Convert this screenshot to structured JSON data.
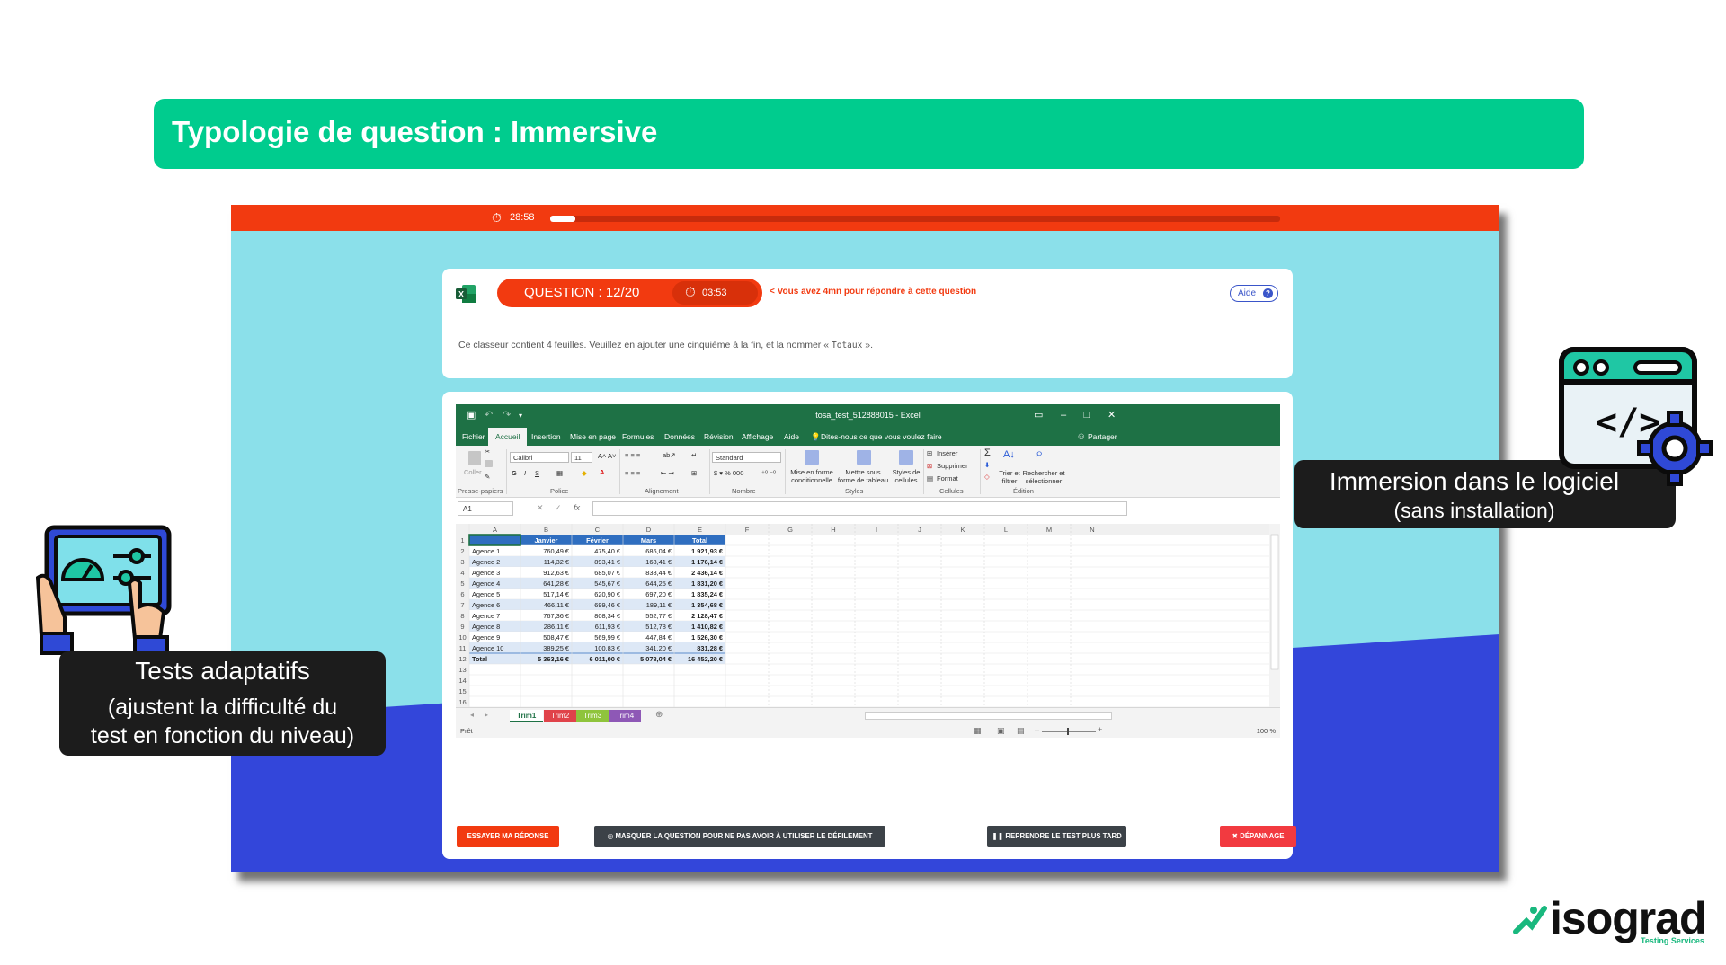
{
  "banner": {
    "title": "Typologie de question : Immersive"
  },
  "test": {
    "global_timer": "28:58",
    "progress": 0.035,
    "question_label": "QUESTION : 12/20",
    "question_timer": "03:53",
    "hint": "< Vous avez 4mn pour répondre à cette question",
    "help_label": "Aide",
    "question_text": "Ce classeur contient 4 feuilles. Veuillez en ajouter une cinquième à la fin, et la nommer «",
    "question_code": "Totaux",
    "question_end": "»."
  },
  "excel": {
    "window_title": "tosa_test_512888015 - Excel",
    "tabs": [
      "Fichier",
      "Accueil",
      "Insertion",
      "Mise en page",
      "Formules",
      "Données",
      "Révision",
      "Affichage",
      "Aide"
    ],
    "tell_me": "Dites-nous ce que vous voulez faire",
    "share": "Partager",
    "ribbon": {
      "paste": "Coller",
      "font": "Calibri",
      "size": "11",
      "number_format": "Standard",
      "cond_format": "Mise en forme conditionnelle",
      "table_format": "Mettre sous forme de tableau",
      "cell_styles": "Styles de cellules",
      "insert": "Insérer",
      "delete": "Supprimer",
      "format": "Format",
      "sort": "Trier et filtrer",
      "find": "Rechercher et sélectionner",
      "groups": [
        "Presse-papiers",
        "Police",
        "Alignement",
        "Nombre",
        "Styles",
        "Cellules",
        "Édition"
      ]
    },
    "name_box": "A1",
    "columns": [
      "A",
      "B",
      "C",
      "D",
      "E",
      "F",
      "G",
      "H",
      "I",
      "J",
      "K",
      "L",
      "M",
      "N"
    ],
    "header_row": [
      "",
      "Janvier",
      "Février",
      "Mars",
      "Total"
    ],
    "rows": [
      [
        "Agence 1",
        "760,49 €",
        "475,40 €",
        "686,04 €",
        "1 921,93 €"
      ],
      [
        "Agence 2",
        "114,32 €",
        "893,41 €",
        "168,41 €",
        "1 176,14 €"
      ],
      [
        "Agence 3",
        "912,63 €",
        "685,07 €",
        "838,44 €",
        "2 436,14 €"
      ],
      [
        "Agence 4",
        "641,28 €",
        "545,67 €",
        "644,25 €",
        "1 831,20 €"
      ],
      [
        "Agence 5",
        "517,14 €",
        "620,90 €",
        "697,20 €",
        "1 835,24 €"
      ],
      [
        "Agence 6",
        "466,11 €",
        "699,46 €",
        "189,11 €",
        "1 354,68 €"
      ],
      [
        "Agence 7",
        "767,36 €",
        "808,34 €",
        "552,77 €",
        "2 128,47 €"
      ],
      [
        "Agence 8",
        "286,11 €",
        "611,93 €",
        "512,78 €",
        "1 410,82 €"
      ],
      [
        "Agence 9",
        "508,47 €",
        "569,99 €",
        "447,84 €",
        "1 526,30 €"
      ],
      [
        "Agence 10",
        "389,25 €",
        "100,83 €",
        "341,20 €",
        "831,28 €"
      ],
      [
        "Total",
        "5 363,16 €",
        "6 011,00 €",
        "5 078,04 €",
        "16 452,20 €"
      ]
    ],
    "row_numbers": [
      "1",
      "2",
      "3",
      "4",
      "5",
      "6",
      "7",
      "8",
      "9",
      "10",
      "11",
      "12",
      "13",
      "14",
      "15",
      "16"
    ],
    "sheets": [
      {
        "name": "Trim1",
        "color": "#ffffff"
      },
      {
        "name": "Trim2",
        "color": "#e0434a"
      },
      {
        "name": "Trim3",
        "color": "#8fc43c"
      },
      {
        "name": "Trim4",
        "color": "#8e58b6"
      }
    ],
    "status": "Prêt",
    "zoom": "100 %"
  },
  "buttons": {
    "try": "ESSAYER MA RÉPONSE",
    "hide": "MASQUER LA QUESTION POUR NE PAS AVOIR À UTILISER LE DÉFILEMENT",
    "later": "REPRENDRE LE TEST PLUS TARD",
    "help": "DÉPANNAGE"
  },
  "callouts": {
    "right_title": "Immersion dans le logiciel",
    "right_sub": "(sans installation)",
    "left_title": "Tests adaptatifs",
    "left_sub1": "(ajustent la difficulté du",
    "left_sub2": "test en fonction du niveau)"
  },
  "logo": {
    "word": "isograd",
    "sub": "Testing Services"
  },
  "colors": {
    "brand_green": "#00cc8e",
    "test_red": "#f23a10",
    "excel_green": "#1e7145",
    "bg_cyan": "#8be0ea",
    "bg_blue": "#3346da"
  }
}
